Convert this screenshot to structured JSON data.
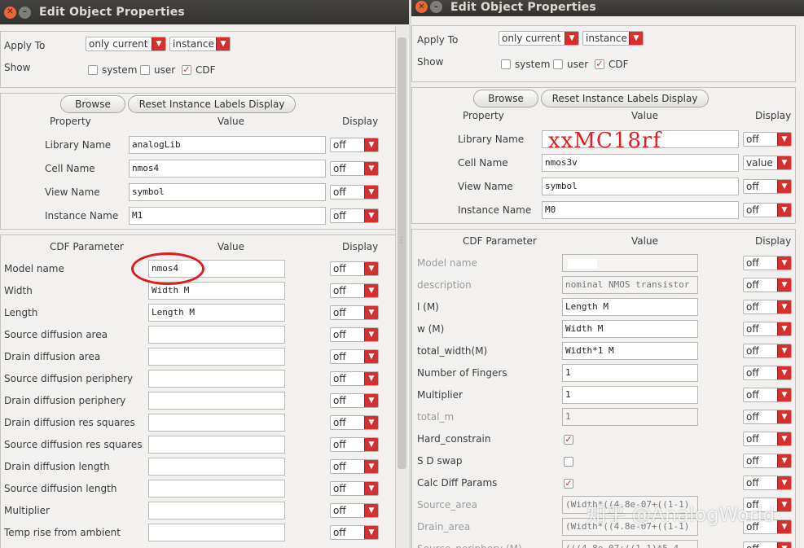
{
  "left": {
    "title": "Edit Object Properties",
    "apply_to_label": "Apply To",
    "apply_to_value": "only current",
    "apply_to_target": "instance",
    "show_label": "Show",
    "show_system": "system",
    "show_user": "user",
    "show_cdf": "CDF",
    "cdf_checked": true,
    "browse": "Browse",
    "reset": "Reset Instance Labels Display",
    "col_property": "Property",
    "col_value": "Value",
    "col_display": "Display",
    "properties": [
      {
        "name": "Library Name",
        "value": "analogLib",
        "display": "off"
      },
      {
        "name": "Cell Name",
        "value": "nmos4",
        "display": "off"
      },
      {
        "name": "View Name",
        "value": "symbol",
        "display": "off"
      },
      {
        "name": "Instance Name",
        "value": "M1",
        "display": "off"
      }
    ],
    "col_cdf": "CDF Parameter",
    "cdf": [
      {
        "name": "Model name",
        "value": "nmos4",
        "display": "off"
      },
      {
        "name": "Width",
        "value": "Width M",
        "display": "off"
      },
      {
        "name": "Length",
        "value": "Length M",
        "display": "off"
      },
      {
        "name": "Source diffusion area",
        "value": "",
        "display": "off"
      },
      {
        "name": "Drain diffusion area",
        "value": "",
        "display": "off"
      },
      {
        "name": "Source diffusion periphery",
        "value": "",
        "display": "off"
      },
      {
        "name": "Drain diffusion periphery",
        "value": "",
        "display": "off"
      },
      {
        "name": "Drain diffusion res squares",
        "value": "",
        "display": "off"
      },
      {
        "name": "Source diffusion res squares",
        "value": "",
        "display": "off"
      },
      {
        "name": "Drain diffusion length",
        "value": "",
        "display": "off"
      },
      {
        "name": "Source diffusion length",
        "value": "",
        "display": "off"
      },
      {
        "name": "Multiplier",
        "value": "",
        "display": "off"
      },
      {
        "name": "Temp rise from ambient",
        "value": "",
        "display": "off"
      }
    ]
  },
  "right": {
    "title": "Edit Object Properties",
    "apply_to_label": "Apply To",
    "apply_to_value": "only current",
    "apply_to_target": "instance",
    "show_label": "Show",
    "show_system": "system",
    "show_user": "user",
    "show_cdf": "CDF",
    "cdf_checked": true,
    "browse": "Browse",
    "reset": "Reset Instance Labels Display",
    "col_property": "Property",
    "col_value": "Value",
    "col_display": "Display",
    "overlay_text": "xxMC18rf",
    "properties": [
      {
        "name": "Library Name",
        "value": "",
        "display": "off"
      },
      {
        "name": "Cell Name",
        "value": "nmos3v",
        "display": "value"
      },
      {
        "name": "View Name",
        "value": "symbol",
        "display": "off"
      },
      {
        "name": "Instance Name",
        "value": "M0",
        "display": "off"
      }
    ],
    "col_cdf": "CDF Parameter",
    "cdf": [
      {
        "name": "Model name",
        "value": "",
        "display": "off",
        "kind": "ro",
        "dim": true
      },
      {
        "name": "description",
        "value": "nominal NMOS transistor",
        "display": "off",
        "kind": "ro",
        "dim": true
      },
      {
        "name": "l (M)",
        "value": "Length M",
        "display": "off",
        "kind": "text"
      },
      {
        "name": "w (M)",
        "value": "Width M",
        "display": "off",
        "kind": "text"
      },
      {
        "name": "total_width(M)",
        "value": "Width*1 M",
        "display": "off",
        "kind": "text"
      },
      {
        "name": "Number of Fingers",
        "value": "1",
        "display": "off",
        "kind": "text"
      },
      {
        "name": "Multiplier",
        "value": "1",
        "display": "off",
        "kind": "text"
      },
      {
        "name": "total_m",
        "value": "1",
        "display": "off",
        "kind": "ro",
        "dim": true
      },
      {
        "name": "Hard_constrain",
        "value": "",
        "display": "off",
        "kind": "check",
        "checked": true
      },
      {
        "name": "S D swap",
        "value": "",
        "display": "off",
        "kind": "check",
        "checked": false
      },
      {
        "name": "Calc Diff Params",
        "value": "",
        "display": "off",
        "kind": "check",
        "checked": true
      },
      {
        "name": "Source_area",
        "value": "(Width*((4.8e-07+((1-1)",
        "display": "off",
        "kind": "ro",
        "dim": true
      },
      {
        "name": "Drain_area",
        "value": "(Width*((4.8e-07+((1-1)",
        "display": "off",
        "kind": "ro",
        "dim": true
      },
      {
        "name": "Source_periphery (M)",
        "value": "(((4.8e-07+((1-1)*5.4",
        "display": "off",
        "kind": "ro",
        "dim": true
      }
    ],
    "watermark": "知乎 @AnalogWorld"
  }
}
